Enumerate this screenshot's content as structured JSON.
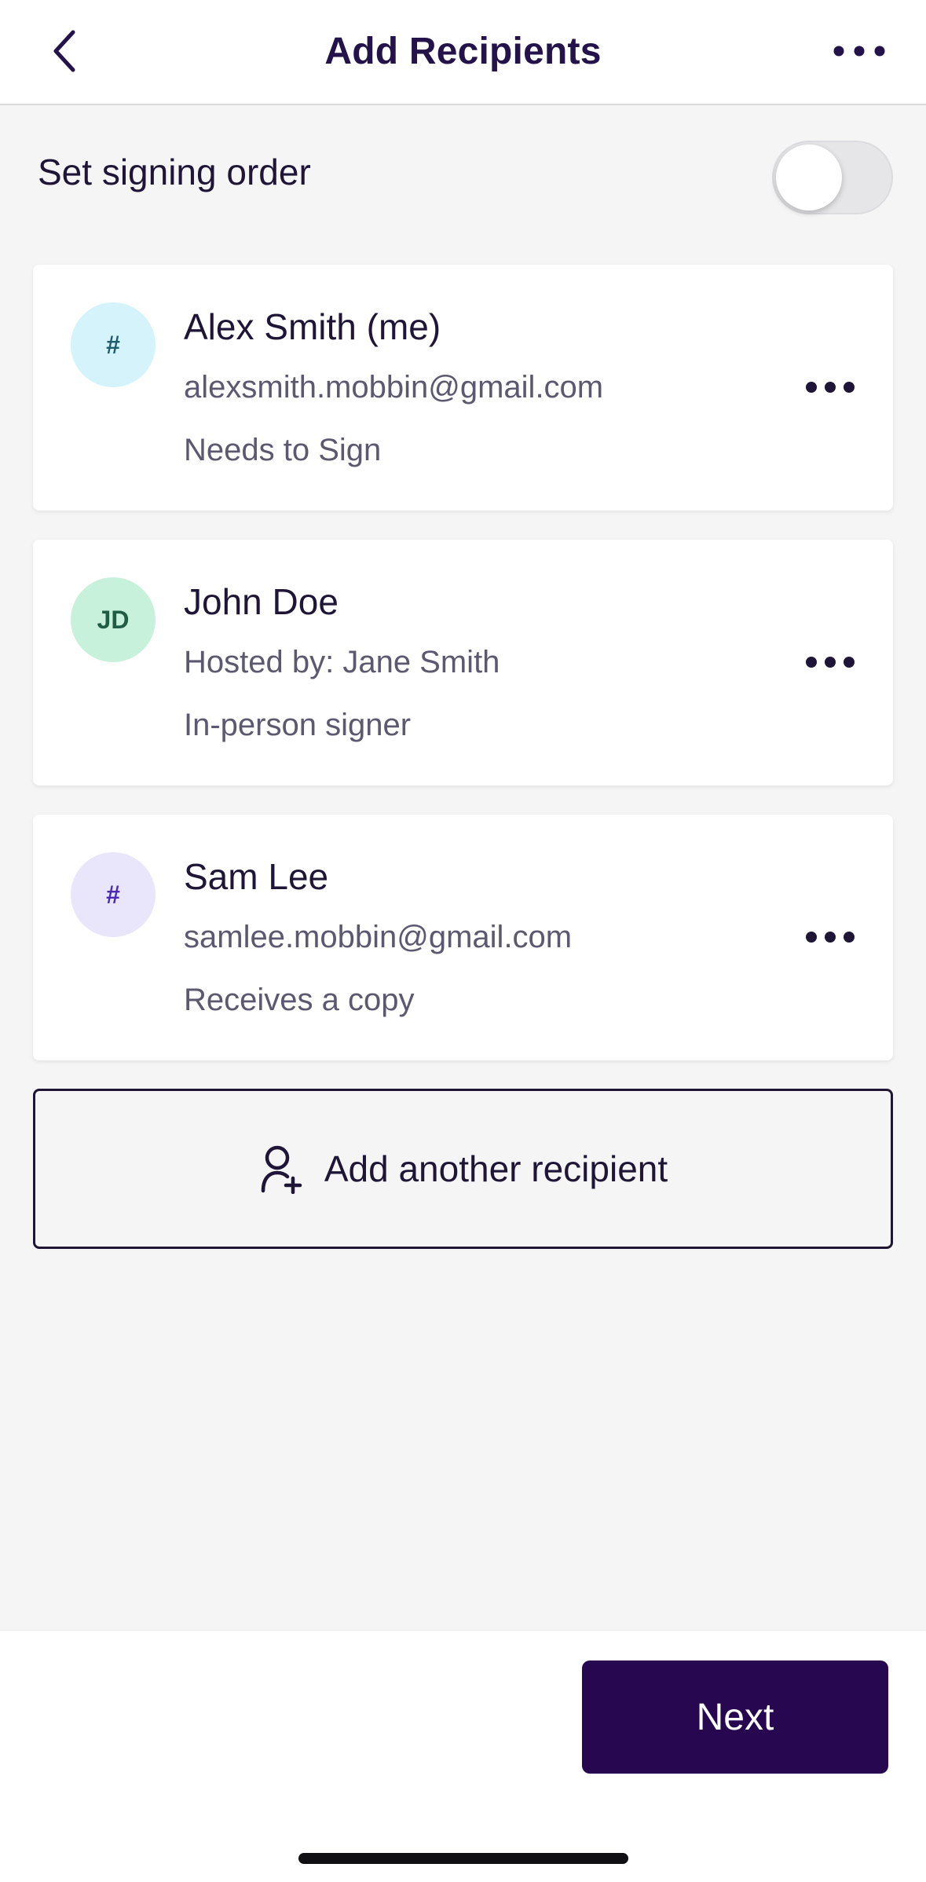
{
  "header": {
    "title": "Add Recipients",
    "back_icon": "chevron-left-icon",
    "more_icon": "more-horizontal-icon"
  },
  "signing_order": {
    "label": "Set signing order",
    "enabled": false
  },
  "recipients": [
    {
      "initials": "#",
      "name": "Alex Smith (me)",
      "detail": "alexsmith.mobbin@gmail.com",
      "role": "Needs to Sign",
      "avatar_bg": "#d5f3fb",
      "avatar_fg": "#1f5d6b"
    },
    {
      "initials": "JD",
      "name": "John Doe",
      "detail": "Hosted by: Jane Smith",
      "role": "In-person signer",
      "avatar_bg": "#c8f1dc",
      "avatar_fg": "#1f5e45"
    },
    {
      "initials": "#",
      "name": "Sam Lee",
      "detail": "samlee.mobbin@gmail.com",
      "role": "Receives a copy",
      "avatar_bg": "#e9e5fb",
      "avatar_fg": "#4a2ab5"
    }
  ],
  "add_recipient": {
    "label": "Add another recipient",
    "icon": "add-person-icon"
  },
  "footer": {
    "next_label": "Next"
  },
  "colors": {
    "primary": "#27074f",
    "text": "#1f1637",
    "muted": "#5b5870",
    "background": "#f5f5f5"
  }
}
